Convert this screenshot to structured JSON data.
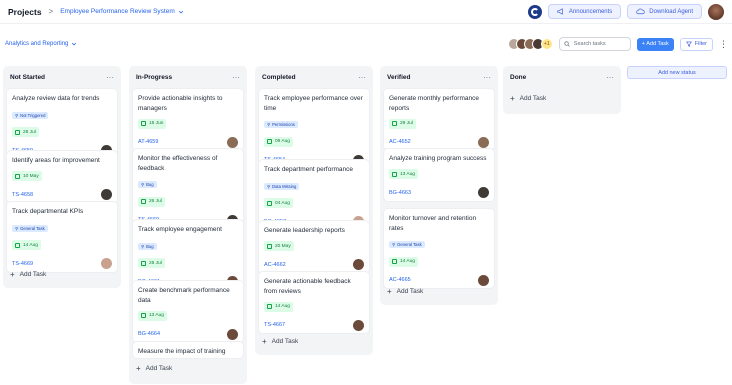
{
  "header": {
    "projects_label": "Projects",
    "separator": ">",
    "breadcrumb": "Employee Performance Review System",
    "announcements_label": "Announcements",
    "download_label": "Download Agent"
  },
  "toolbar": {
    "view_label": "Analytics and Reporting",
    "more_members": "+1",
    "search_placeholder": "Search tasks",
    "add_task_label": "+ Add Task",
    "filter_label": "Filter"
  },
  "add_status_label": "Add new status",
  "add_task_row_label": "Add Task",
  "columns": [
    {
      "title": "Not Started",
      "cards": [
        {
          "title": "Analyze review data for trends",
          "badge": "Not Triggered",
          "date": "28 Jul",
          "id": "TS-4659"
        },
        {
          "title": "Identify areas for improvement",
          "date": "10 May",
          "id": "TS-4658"
        },
        {
          "title": "Track departmental KPIs",
          "badge": "General Task",
          "date": "14 Aug",
          "id": "TS-4669"
        }
      ]
    },
    {
      "title": "In-Progress",
      "cards": [
        {
          "title": "Provide actionable insights to managers",
          "date": "15 Jun",
          "id": "AT-4659"
        },
        {
          "title": "Monitor the effectiveness of feedback",
          "badge": "Bug",
          "date": "26 Jul",
          "id": "TS-4660"
        },
        {
          "title": "Track employee engagement",
          "badge": "Bug",
          "date": "25 Jul",
          "id": "BG-4661"
        },
        {
          "title": "Create benchmark performance data",
          "date": "13 Aug",
          "id": "BG-4664"
        },
        {
          "title": "Measure the impact of training"
        }
      ]
    },
    {
      "title": "Completed",
      "cards": [
        {
          "title": "Track employee performance over time",
          "badge": "Permissions",
          "date": "09 Aug",
          "id": "TS-4654"
        },
        {
          "title": "Track department performance",
          "badge": "Data Missing",
          "date": "04 Aug",
          "id": "BG-4657"
        },
        {
          "title": "Generate leadership reports",
          "date": "20 May",
          "id": "AC-4662"
        },
        {
          "title": "Generate actionable feedback from reviews",
          "date": "14 Aug",
          "id": "TS-4667"
        }
      ]
    },
    {
      "title": "Verified",
      "cards": [
        {
          "title": "Generate monthly performance reports",
          "date": "29 Jul",
          "id": "AC-4652"
        },
        {
          "title": "Analyze training program success",
          "date": "13 Aug",
          "id": "BG-4663"
        },
        {
          "title": "Monitor turnover and retention rates",
          "badge": "General Task",
          "date": "14 Aug",
          "id": "AC-4665"
        }
      ]
    },
    {
      "title": "Done",
      "cards": []
    }
  ]
}
